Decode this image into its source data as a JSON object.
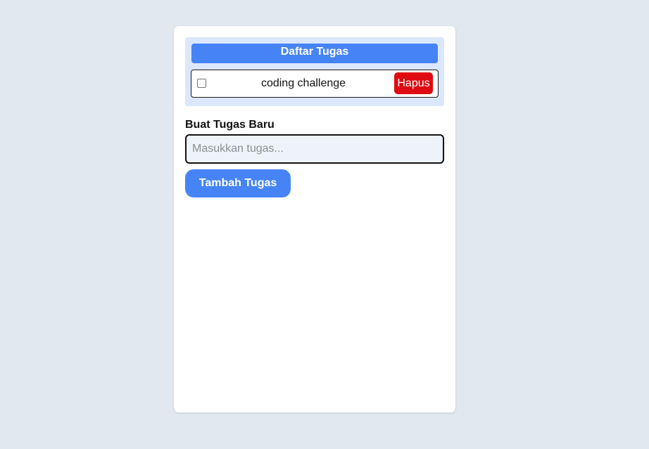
{
  "colors": {
    "page_bg": "#e2e8f0",
    "accent": "#4684f6",
    "danger": "#e00b12",
    "list_panel_bg": "#dbe7fd"
  },
  "task_list": {
    "title": "Daftar Tugas",
    "items": [
      {
        "text": "coding challenge",
        "checked": false,
        "delete_label": "Hapus"
      }
    ]
  },
  "new_task_form": {
    "label": "Buat Tugas Baru",
    "input_value": "",
    "input_placeholder": "Masukkan tugas...",
    "submit_label": "Tambah Tugas"
  }
}
